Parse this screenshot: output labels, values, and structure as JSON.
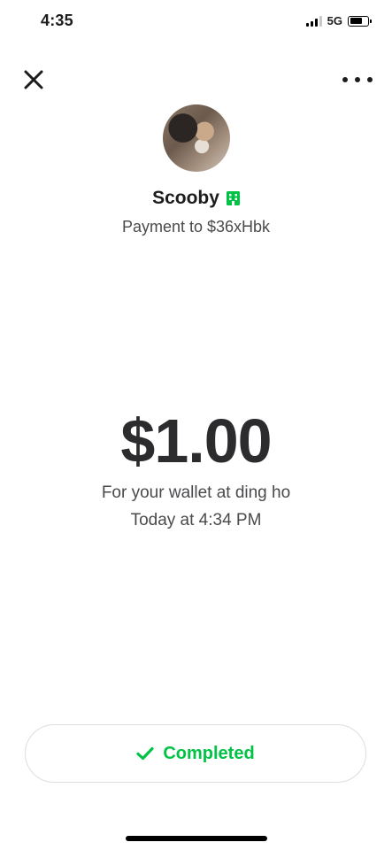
{
  "status_bar": {
    "time": "4:35",
    "network": "5G"
  },
  "header": {
    "close_icon": "close-icon",
    "more_icon": "more-icon"
  },
  "profile": {
    "name": "Scooby",
    "business_icon": "business-building-icon",
    "business_icon_color": "#00c244",
    "subtitle": "Payment to $36xHbk"
  },
  "payment": {
    "amount": "$1.00",
    "note": "For your wallet at ding ho",
    "timestamp": "Today at 4:34 PM"
  },
  "status": {
    "label": "Completed",
    "icon": "checkmark-icon",
    "color": "#00c244"
  }
}
